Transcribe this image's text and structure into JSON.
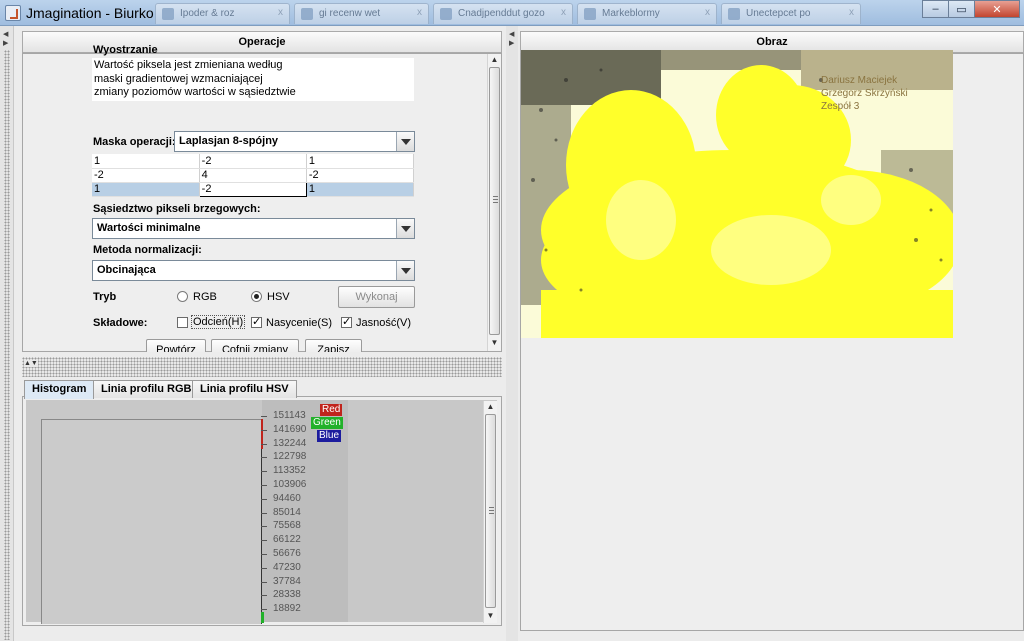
{
  "window": {
    "title": "Jmagination - Biurko",
    "background_tabs": [
      "Ipoder & roz",
      "gi recenw wet",
      "Cnadjpenddut gozo",
      "Markeblormy",
      "Unectepcet po"
    ],
    "controls": {
      "minimize": "‒",
      "maximize": "▭",
      "close": "✕"
    }
  },
  "operations_panel": {
    "header": "Operacje",
    "operation_title": "Wyostrzanie",
    "description": [
      "Wartość piksela jest zmieniana według",
      "maski gradientowej wzmacniającej",
      "zmiany poziomów wartości w sąsiedztwie"
    ],
    "mask_label": "Maska operacji:",
    "mask_value": "Laplasjan 8-spójny",
    "mask_matrix": [
      [
        "1",
        "-2",
        "1"
      ],
      [
        "-2",
        "4",
        "-2"
      ],
      [
        "1",
        "-2",
        "1"
      ]
    ],
    "border_label": "Sąsiedztwo pikseli brzegowych:",
    "border_value": "Wartości minimalne",
    "norm_label": "Metoda normalizacji:",
    "norm_value": "Obcinająca",
    "mode_label": "Tryb",
    "mode_rgb": "RGB",
    "mode_hsv": "HSV",
    "mode_selected": "HSV",
    "execute_button": "Wykonaj",
    "components_label": "Składowe:",
    "comp_h": {
      "label": "Odcień(H)",
      "checked": false
    },
    "comp_s": {
      "label": "Nasycenie(S)",
      "checked": true
    },
    "comp_v": {
      "label": "Jasność(V)",
      "checked": true
    },
    "buttons": [
      "Powtórz",
      "Cofnij zmiany",
      "Zapisz"
    ]
  },
  "histogram_panel": {
    "tabs": [
      "Histogram",
      "Linia profilu RGB",
      "Linia profilu HSV"
    ],
    "active_tab": "Histogram",
    "legend": [
      {
        "label": "Red",
        "color": "#c0241c"
      },
      {
        "label": "Green",
        "color": "#22b12a"
      },
      {
        "label": "Blue",
        "color": "#1c1c9e"
      }
    ],
    "y_ticks": [
      "151143",
      "141690",
      "132244",
      "122798",
      "113352",
      "103906",
      "94460",
      "85014",
      "75568",
      "66122",
      "56676",
      "47230",
      "37784",
      "28338",
      "18892"
    ]
  },
  "image_panel": {
    "header": "Obraz",
    "overlay_text": [
      "Dariusz Maciejek",
      "Grzegorz Skrzyński",
      "Zespół 3"
    ]
  }
}
